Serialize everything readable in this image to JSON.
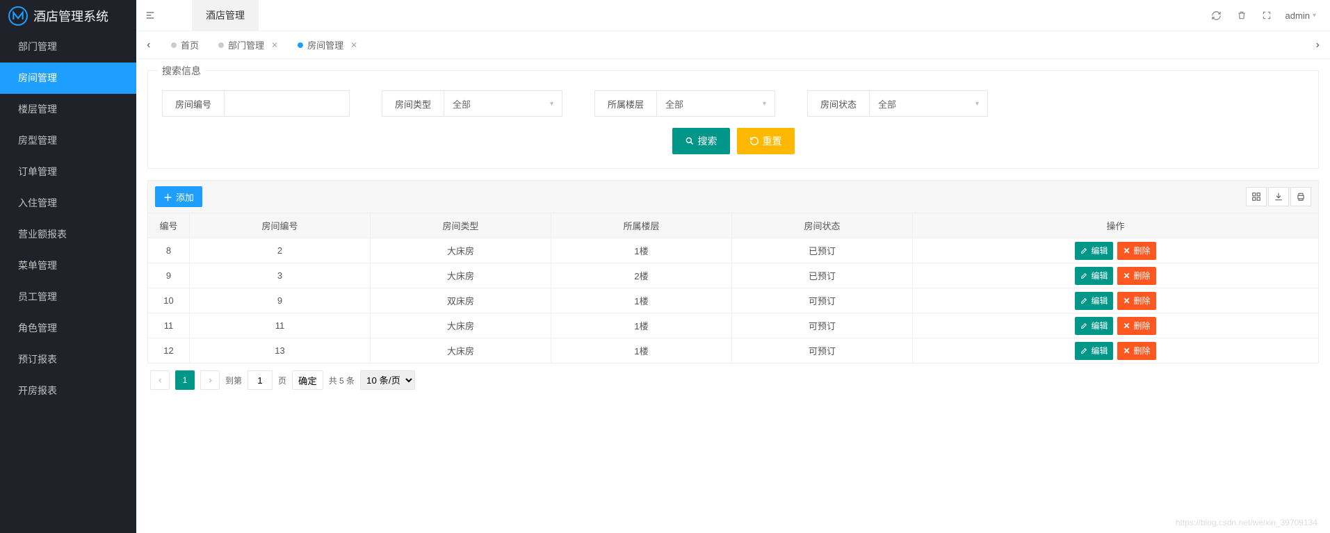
{
  "app": {
    "title": "酒店管理系统"
  },
  "sidebar": {
    "items": [
      {
        "label": "部门管理"
      },
      {
        "label": "房间管理"
      },
      {
        "label": "楼层管理"
      },
      {
        "label": "房型管理"
      },
      {
        "label": "订单管理"
      },
      {
        "label": "入住管理"
      },
      {
        "label": "营业额报表"
      },
      {
        "label": "菜单管理"
      },
      {
        "label": "员工管理"
      },
      {
        "label": "角色管理"
      },
      {
        "label": "预订报表"
      },
      {
        "label": "开房报表"
      }
    ],
    "activeIndex": 1
  },
  "topbar": {
    "tab": "酒店管理",
    "user": "admin"
  },
  "tabs": [
    {
      "label": "首页",
      "closable": false
    },
    {
      "label": "部门管理",
      "closable": true
    },
    {
      "label": "房间管理",
      "closable": true
    }
  ],
  "tabsActiveIndex": 2,
  "search": {
    "legend": "搜索信息",
    "fields": {
      "roomNo": {
        "label": "房间编号",
        "value": ""
      },
      "roomType": {
        "label": "房间类型",
        "value": "全部"
      },
      "floor": {
        "label": "所属楼层",
        "value": "全部"
      },
      "status": {
        "label": "房间状态",
        "value": "全部"
      }
    },
    "searchBtn": "搜索",
    "resetBtn": "重置"
  },
  "toolbar": {
    "addBtn": "添加"
  },
  "table": {
    "columns": [
      "编号",
      "房间编号",
      "房间类型",
      "所属楼层",
      "房间状态",
      "操作"
    ],
    "rows": [
      {
        "id": "8",
        "roomNo": "2",
        "type": "大床房",
        "floor": "1楼",
        "status": "已预订"
      },
      {
        "id": "9",
        "roomNo": "3",
        "type": "大床房",
        "floor": "2楼",
        "status": "已预订"
      },
      {
        "id": "10",
        "roomNo": "9",
        "type": "双床房",
        "floor": "1楼",
        "status": "可预订"
      },
      {
        "id": "11",
        "roomNo": "11",
        "type": "大床房",
        "floor": "1楼",
        "status": "可预订"
      },
      {
        "id": "12",
        "roomNo": "13",
        "type": "大床房",
        "floor": "1楼",
        "status": "可预订"
      }
    ],
    "editBtn": "编辑",
    "deleteBtn": "删除"
  },
  "pagination": {
    "current": "1",
    "gotoPrefix": "到第",
    "gotoValue": "1",
    "gotoSuffix": "页",
    "confirm": "确定",
    "total": "共 5 条",
    "perPage": "10 条/页"
  },
  "watermark": "https://blog.csdn.net/weixin_39709134"
}
